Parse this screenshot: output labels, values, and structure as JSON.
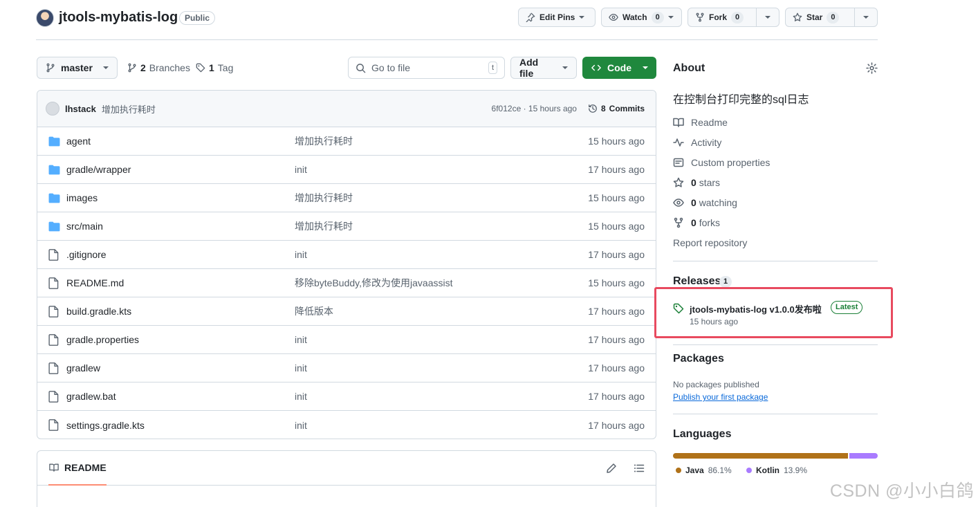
{
  "repo": {
    "name": "jtools-mybatis-log",
    "visibility": "Public"
  },
  "header_buttons": {
    "edit_pins": "Edit Pins",
    "watch": "Watch",
    "watch_count": "0",
    "fork": "Fork",
    "fork_count": "0",
    "star": "Star",
    "star_count": "0"
  },
  "controls": {
    "branch": "master",
    "branches_count": "2",
    "branches_label": "Branches",
    "tags_count": "1",
    "tags_label": "Tag",
    "goto_placeholder": "Go to file",
    "goto_kbd": "t",
    "add_file": "Add file",
    "code": "Code"
  },
  "latest_commit": {
    "author": "lhstack",
    "message": "增加执行耗时",
    "hash_time": "6f012ce · 15 hours ago",
    "commits_count": "8",
    "commits_label": "Commits"
  },
  "files": [
    {
      "type": "dir",
      "name": "agent",
      "message": "增加执行耗时",
      "age": "15 hours ago"
    },
    {
      "type": "dir",
      "name": "gradle/wrapper",
      "message": "init",
      "age": "17 hours ago"
    },
    {
      "type": "dir",
      "name": "images",
      "message": "增加执行耗时",
      "age": "15 hours ago"
    },
    {
      "type": "dir",
      "name": "src/main",
      "message": "增加执行耗时",
      "age": "15 hours ago"
    },
    {
      "type": "file",
      "name": ".gitignore",
      "message": "init",
      "age": "17 hours ago"
    },
    {
      "type": "file",
      "name": "README.md",
      "message": "移除byteBuddy,修改为使用javaassist",
      "age": "15 hours ago"
    },
    {
      "type": "file",
      "name": "build.gradle.kts",
      "message": "降低版本",
      "age": "17 hours ago"
    },
    {
      "type": "file",
      "name": "gradle.properties",
      "message": "init",
      "age": "17 hours ago"
    },
    {
      "type": "file",
      "name": "gradlew",
      "message": "init",
      "age": "17 hours ago"
    },
    {
      "type": "file",
      "name": "gradlew.bat",
      "message": "init",
      "age": "17 hours ago"
    },
    {
      "type": "file",
      "name": "settings.gradle.kts",
      "message": "init",
      "age": "17 hours ago"
    }
  ],
  "readme_tab": "README",
  "about": {
    "title": "About",
    "description": "在控制台打印完整的sql日志",
    "readme": "Readme",
    "activity": "Activity",
    "custom_properties": "Custom properties",
    "stars_count": "0",
    "stars_label": "stars",
    "watching_count": "0",
    "watching_label": "watching",
    "forks_count": "0",
    "forks_label": "forks",
    "report": "Report repository"
  },
  "releases": {
    "title": "Releases",
    "count": "1",
    "release_name": "jtools-mybatis-log v1.0.0发布啦",
    "badge": "Latest",
    "time": "15 hours ago"
  },
  "packages": {
    "title": "Packages",
    "none_text": "No packages published",
    "publish_link": "Publish your first package"
  },
  "languages": {
    "title": "Languages",
    "items": [
      {
        "name": "Java",
        "percent": "86.1%",
        "value": 86.1,
        "color": "#b07219"
      },
      {
        "name": "Kotlin",
        "percent": "13.9%",
        "value": 13.9,
        "color": "#a97bff"
      }
    ]
  },
  "watermark": "CSDN @小小白鸽"
}
